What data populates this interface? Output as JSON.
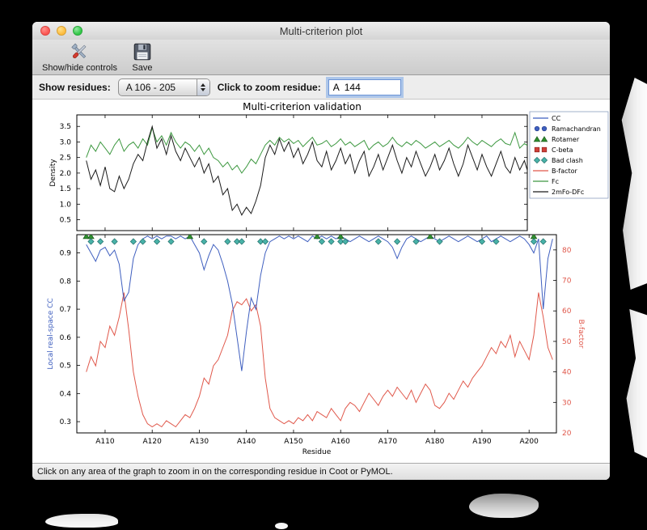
{
  "window": {
    "title": "Multi-criterion plot",
    "toolbar": {
      "show_hide_label": "Show/hide controls",
      "save_label": "Save"
    },
    "controls": {
      "show_residues_label": "Show residues:",
      "residue_range_value": "A 106 - 205",
      "zoom_label": "Click to zoom residue:",
      "zoom_value": "A  144"
    },
    "status_text": "Click on any area of the graph to zoom in on the corresponding residue in Coot or PyMOL."
  },
  "chart_data": {
    "type": "line",
    "title": "Multi-criterion validation",
    "xlabel": "Residue",
    "x_start": 106,
    "x_end": 205,
    "x_tick_residues": [
      110,
      120,
      130,
      140,
      150,
      160,
      170,
      180,
      190,
      200
    ],
    "x_tick_labels": [
      "A110",
      "A120",
      "A130",
      "A140",
      "A150",
      "A160",
      "A170",
      "A180",
      "A190",
      "A200"
    ],
    "top": {
      "ylabel": "Density",
      "ylim": [
        0.15,
        3.87
      ],
      "yticks": [
        0.5,
        1.0,
        1.5,
        2.0,
        2.5,
        3.0,
        3.5
      ],
      "series": [
        {
          "name": "Fc",
          "color": "#3d9840",
          "values": [
            2.5,
            2.9,
            2.7,
            3.0,
            2.8,
            2.6,
            2.9,
            3.1,
            2.7,
            2.9,
            3.0,
            2.8,
            3.1,
            2.9,
            3.45,
            3.0,
            3.2,
            2.9,
            3.3,
            3.0,
            2.8,
            3.0,
            2.9,
            2.7,
            2.9,
            2.6,
            2.8,
            2.5,
            2.4,
            2.2,
            2.35,
            2.1,
            2.25,
            2.0,
            2.2,
            2.45,
            2.3,
            2.6,
            2.9,
            3.05,
            2.9,
            3.15,
            3.0,
            3.1,
            2.95,
            3.05,
            2.85,
            3.0,
            3.15,
            2.9,
            2.95,
            3.05,
            2.85,
            2.95,
            3.1,
            2.9,
            3.0,
            2.85,
            2.95,
            3.05,
            2.75,
            2.9,
            3.0,
            2.85,
            2.95,
            3.15,
            2.95,
            2.85,
            3.0,
            2.9,
            3.05,
            2.95,
            2.8,
            2.9,
            3.0,
            2.85,
            2.95,
            3.05,
            2.9,
            2.8,
            2.95,
            3.15,
            3.0,
            2.9,
            3.05,
            2.95,
            2.85,
            3.0,
            3.1,
            2.95,
            2.9,
            3.3,
            2.8,
            2.95,
            2.85,
            2.9,
            3.4,
            2.7,
            2.95,
            2.8
          ]
        },
        {
          "name": "2mFo-DFc",
          "color": "#1a1a1a",
          "values": [
            2.4,
            1.8,
            2.1,
            1.6,
            2.2,
            1.5,
            1.4,
            1.9,
            1.5,
            1.8,
            2.3,
            2.6,
            2.4,
            3.0,
            3.5,
            2.8,
            3.1,
            2.6,
            3.2,
            2.7,
            2.4,
            2.8,
            2.5,
            2.2,
            2.5,
            2.0,
            2.3,
            1.7,
            1.9,
            1.3,
            1.5,
            0.8,
            1.0,
            0.65,
            0.9,
            0.7,
            1.1,
            1.6,
            2.5,
            2.9,
            2.6,
            3.1,
            2.7,
            3.0,
            2.5,
            2.8,
            2.3,
            2.6,
            3.0,
            2.4,
            2.2,
            2.7,
            2.1,
            2.4,
            2.8,
            2.3,
            2.6,
            2.0,
            2.4,
            2.7,
            1.9,
            2.2,
            2.6,
            2.1,
            2.5,
            2.9,
            2.4,
            2.0,
            2.5,
            2.2,
            2.7,
            2.3,
            1.9,
            2.2,
            2.6,
            2.1,
            2.4,
            2.8,
            2.3,
            1.9,
            2.3,
            2.9,
            2.5,
            2.1,
            2.6,
            2.2,
            1.9,
            2.3,
            2.7,
            2.2,
            2.0,
            2.5,
            2.1,
            2.4,
            1.9,
            2.2,
            2.8,
            1.8,
            2.3,
            2.1
          ]
        }
      ]
    },
    "bottom": {
      "ylabel_left": "Local real-space CC",
      "ylim_left": [
        0.26,
        0.965
      ],
      "yticks_left": [
        0.3,
        0.4,
        0.5,
        0.6,
        0.7,
        0.8,
        0.9
      ],
      "ylabel_right": "B-factor",
      "ylim_right": [
        20,
        85
      ],
      "yticks_right": [
        20,
        30,
        40,
        50,
        60,
        70,
        80
      ],
      "series": [
        {
          "name": "CC",
          "axis": "left",
          "color": "#3f5fbf",
          "values": [
            0.93,
            0.9,
            0.87,
            0.91,
            0.92,
            0.89,
            0.91,
            0.86,
            0.73,
            0.76,
            0.88,
            0.93,
            0.95,
            0.96,
            0.95,
            0.96,
            0.95,
            0.96,
            0.96,
            0.95,
            0.96,
            0.95,
            0.96,
            0.93,
            0.9,
            0.84,
            0.89,
            0.93,
            0.91,
            0.86,
            0.8,
            0.72,
            0.6,
            0.48,
            0.62,
            0.74,
            0.7,
            0.82,
            0.9,
            0.94,
            0.95,
            0.96,
            0.95,
            0.96,
            0.95,
            0.96,
            0.95,
            0.94,
            0.96,
            0.95,
            0.96,
            0.95,
            0.96,
            0.95,
            0.96,
            0.95,
            0.94,
            0.95,
            0.96,
            0.95,
            0.94,
            0.95,
            0.96,
            0.95,
            0.94,
            0.92,
            0.88,
            0.92,
            0.95,
            0.96,
            0.95,
            0.94,
            0.95,
            0.96,
            0.95,
            0.94,
            0.95,
            0.96,
            0.95,
            0.94,
            0.95,
            0.96,
            0.95,
            0.94,
            0.95,
            0.96,
            0.94,
            0.95,
            0.96,
            0.95,
            0.94,
            0.95,
            0.96,
            0.95,
            0.93,
            0.9,
            0.95,
            0.7,
            0.88,
            0.95
          ]
        },
        {
          "name": "B-factor",
          "axis": "right",
          "color": "#e0584b",
          "values": [
            40,
            45,
            42,
            50,
            48,
            55,
            52,
            58,
            66,
            54,
            40,
            32,
            26,
            23,
            22,
            23,
            22,
            24,
            23,
            22,
            24,
            26,
            25,
            28,
            32,
            38,
            36,
            42,
            44,
            48,
            52,
            60,
            63,
            62,
            64,
            60,
            62,
            55,
            38,
            28,
            25,
            24,
            23,
            24,
            23,
            25,
            24,
            26,
            24,
            27,
            26,
            25,
            28,
            26,
            24,
            28,
            30,
            29,
            27,
            30,
            33,
            31,
            29,
            32,
            34,
            32,
            35,
            33,
            31,
            34,
            30,
            33,
            36,
            34,
            29,
            28,
            30,
            33,
            31,
            34,
            37,
            35,
            38,
            40,
            42,
            45,
            48,
            46,
            50,
            48,
            52,
            45,
            50,
            47,
            44,
            52,
            66,
            58,
            48,
            44
          ]
        }
      ],
      "markers": [
        {
          "name": "Rotamer",
          "shape": "triangle",
          "color": "#2f8f2f",
          "edge": "#1d5c1d",
          "residues": [
            106,
            107,
            128,
            155,
            160,
            179,
            201
          ]
        },
        {
          "name": "Bad clash",
          "shape": "diamond",
          "color": "#49b2a8",
          "edge": "#23706b",
          "residues": [
            107,
            109,
            112,
            116,
            118,
            121,
            124,
            131,
            136,
            138,
            139,
            143,
            144,
            156,
            158,
            160,
            161,
            168,
            172,
            176,
            181,
            190,
            193,
            201,
            203
          ]
        }
      ]
    },
    "legend": [
      {
        "label": "CC",
        "type": "line",
        "color": "#3f5fbf"
      },
      {
        "label": "Ramachandran",
        "type": "marker",
        "shape": "circle",
        "color": "#3f5fbf",
        "edge": "#27408f"
      },
      {
        "label": "Rotamer",
        "type": "marker",
        "shape": "triangle",
        "color": "#2f8f2f",
        "edge": "#1d5c1d"
      },
      {
        "label": "C-beta",
        "type": "marker",
        "shape": "square",
        "color": "#d04038",
        "edge": "#8f241e"
      },
      {
        "label": "Bad clash",
        "type": "marker",
        "shape": "diamond",
        "color": "#49b2a8",
        "edge": "#23706b"
      },
      {
        "label": "B-factor",
        "type": "line",
        "color": "#e0584b"
      },
      {
        "label": "Fc",
        "type": "line",
        "color": "#3d9840"
      },
      {
        "label": "2mFo-DFc",
        "type": "line",
        "color": "#1a1a1a"
      }
    ]
  }
}
